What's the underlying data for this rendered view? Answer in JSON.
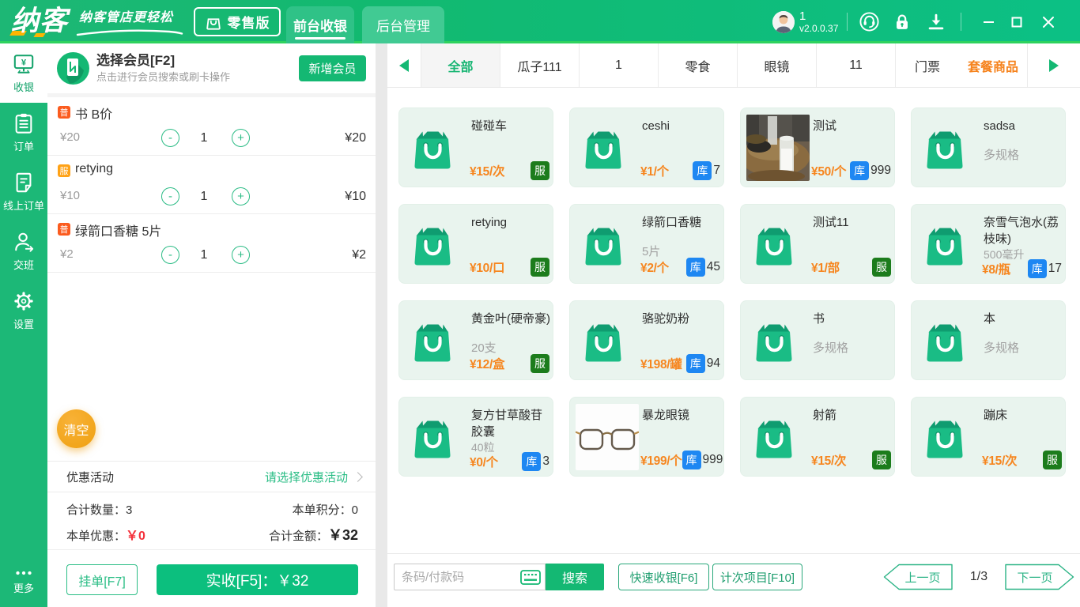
{
  "colors": {
    "brand_green": "#14b873",
    "header_green": "#12b970",
    "header_line": "#2ed25e",
    "accent_green_button": "#0cbf7e",
    "outline_green": "#2abd85",
    "price_orange": "#f6861f",
    "highlight_orange": "#f6831d",
    "badge_normal_red": "#fb5b1e",
    "badge_service_amber": "#ffa216",
    "badge_service_green": "#1c7c1c",
    "badge_stock_blue": "#1e87f2",
    "discount_red": "#f4323c",
    "logo_yellow": "#ffb501"
  },
  "header": {
    "logo": "纳客",
    "tagline": "纳客管店更轻松",
    "edition_badge": "零售版",
    "tabs": [
      {
        "label": "前台收银",
        "active": true
      },
      {
        "label": "后台管理",
        "active": false
      }
    ],
    "user": {
      "name": "1",
      "version": "v2.0.0.37"
    }
  },
  "sidebar": {
    "items": [
      {
        "label": "收银",
        "icon": "cashier-monitor-icon",
        "active": true
      },
      {
        "label": "订单",
        "icon": "orders-clipboard-icon",
        "active": false
      },
      {
        "label": "线上订单",
        "icon": "online-orders-icon",
        "active": false
      },
      {
        "label": "交班",
        "icon": "shift-person-icon",
        "active": false
      },
      {
        "label": "设置",
        "icon": "settings-gear-icon",
        "active": false
      }
    ],
    "more_label": "更多"
  },
  "member": {
    "title": "选择会员[F2]",
    "subtitle": "点击进行会员搜索或刷卡操作",
    "add_button": "新增会员"
  },
  "cart": {
    "items": [
      {
        "badge": "普",
        "badge_type": "normal",
        "name": "书 B价",
        "unit_price": "¥20",
        "qty": "1",
        "total": "¥20"
      },
      {
        "badge": "服",
        "badge_type": "service",
        "name": "retying",
        "unit_price": "¥10",
        "qty": "1",
        "total": "¥10"
      },
      {
        "badge": "普",
        "badge_type": "normal",
        "name": "绿箭口香糖 5片",
        "unit_price": "¥2",
        "qty": "1",
        "total": "¥2"
      }
    ],
    "minus_label": "-",
    "plus_label": "+",
    "clear_button": "清空",
    "promo_label": "优惠活动",
    "promo_value": "请选择优惠活动",
    "summary": {
      "qty_label": "合计数量：",
      "qty": "3",
      "points_label": "本单积分：",
      "points": "0",
      "discount_label": "本单优惠：",
      "discount": "￥0",
      "total_label": "合计金额：",
      "total": "￥32"
    },
    "hold_button": "挂单[F7]",
    "checkout_button": "实收[F5]：￥32"
  },
  "categories": {
    "items": [
      {
        "label": "全部",
        "state": "active"
      },
      {
        "label": "瓜子111",
        "state": ""
      },
      {
        "label": "1",
        "state": ""
      },
      {
        "label": "零食",
        "state": ""
      },
      {
        "label": "眼镜",
        "state": ""
      },
      {
        "label": "11",
        "state": ""
      },
      {
        "label": "门票",
        "state": "narrow"
      },
      {
        "label": "套餐商品",
        "state": "highlight"
      }
    ]
  },
  "products": [
    {
      "name": "碰碰车",
      "spec": "",
      "price": "¥15/次",
      "badge": "服",
      "stock": "",
      "image": "bag"
    },
    {
      "name": "ceshi",
      "spec": "",
      "price": "¥1/个",
      "badge": "库",
      "stock": "7",
      "image": "bag"
    },
    {
      "name": "测试",
      "spec": "",
      "price": "¥50/个",
      "badge": "库",
      "stock": "999",
      "image": "photo-drink"
    },
    {
      "name": "sadsa",
      "spec": "多规格",
      "price": "",
      "badge": "",
      "stock": "",
      "image": "bag"
    },
    {
      "name": "retying",
      "spec": "",
      "price": "¥10/口",
      "badge": "服",
      "stock": "",
      "image": "bag"
    },
    {
      "name": "绿箭口香糖",
      "spec": "5片",
      "price": "¥2/个",
      "badge": "库",
      "stock": "45",
      "image": "bag"
    },
    {
      "name": "测试11",
      "spec": "",
      "price": "¥1/部",
      "badge": "服",
      "stock": "",
      "image": "bag"
    },
    {
      "name": "奈雪气泡水(荔枝味)",
      "spec": "500毫升",
      "price": "¥8/瓶",
      "badge": "库",
      "stock": "17",
      "image": "bag"
    },
    {
      "name": "黄金叶(硬帝豪)",
      "spec": "20支",
      "price": "¥12/盒",
      "badge": "服",
      "stock": "",
      "image": "bag"
    },
    {
      "name": "骆驼奶粉",
      "spec": "",
      "price": "¥198/罐",
      "badge": "库",
      "stock": "94",
      "image": "bag"
    },
    {
      "name": "书",
      "spec": "多规格",
      "price": "",
      "badge": "",
      "stock": "",
      "image": "bag"
    },
    {
      "name": "本",
      "spec": "多规格",
      "price": "",
      "badge": "",
      "stock": "",
      "image": "bag"
    },
    {
      "name": "复方甘草酸苷胶囊",
      "spec": "40粒",
      "price": "¥0/个",
      "badge": "库",
      "stock": "3",
      "image": "bag"
    },
    {
      "name": "暴龙眼镜",
      "spec": "",
      "price": "¥199/个",
      "badge": "库",
      "stock": "999",
      "image": "photo-glasses"
    },
    {
      "name": "射箭",
      "spec": "",
      "price": "¥15/次",
      "badge": "服",
      "stock": "",
      "image": "bag"
    },
    {
      "name": "蹦床",
      "spec": "",
      "price": "¥15/次",
      "badge": "服",
      "stock": "",
      "image": "bag"
    }
  ],
  "bottombar": {
    "search_placeholder": "条码/付款码",
    "search_button": "搜索",
    "quick_button": "快速收银[F6]",
    "count_button": "计次项目[F10]",
    "prev_button": "上一页",
    "page_indicator": "1/3",
    "next_button": "下一页"
  }
}
